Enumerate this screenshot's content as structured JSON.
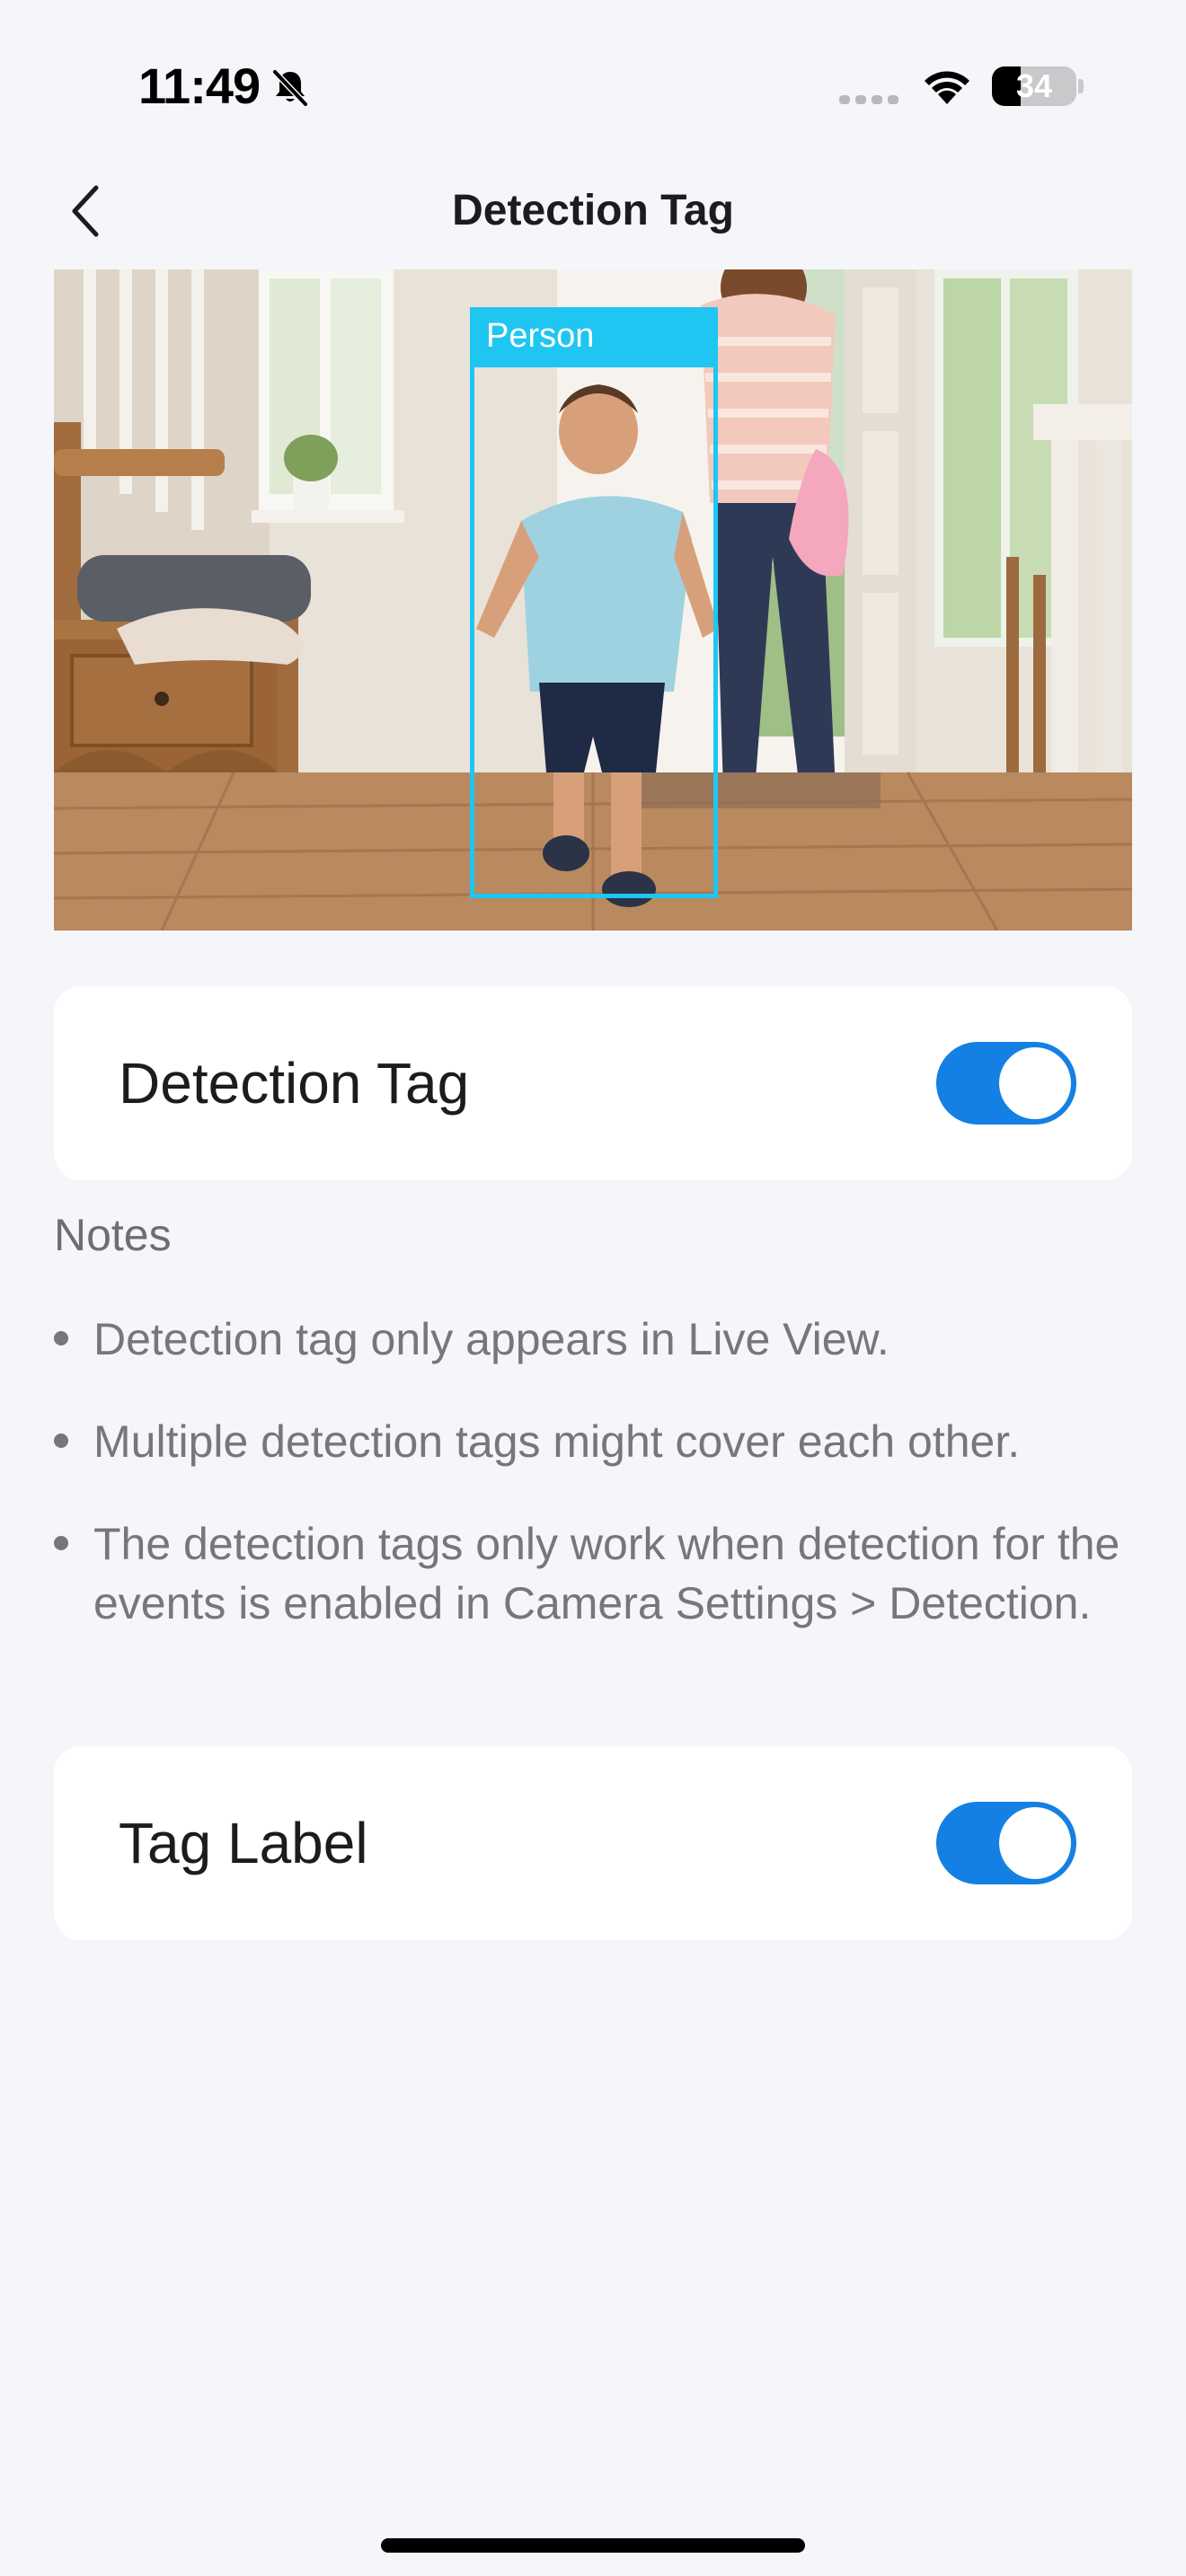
{
  "status_bar": {
    "time": "11:49",
    "battery_level": "34",
    "icons": [
      "bell-slash-icon",
      "cellular-signal-icon",
      "wifi-icon",
      "battery-icon"
    ]
  },
  "nav": {
    "title": "Detection Tag",
    "back_icon": "chevron-left-icon"
  },
  "preview": {
    "detection_label": "Person",
    "accent_color": "#1fc6f2"
  },
  "settings": {
    "detection_tag": {
      "label": "Detection Tag",
      "enabled": true
    },
    "tag_label": {
      "label": "Tag Label",
      "enabled": true
    }
  },
  "notes": {
    "title": "Notes",
    "items": [
      "Detection tag only appears in Live View.",
      "Multiple detection tags might cover each other.",
      "The detection tags only work when detection for the events is enabled in Camera Settings > Detection."
    ]
  },
  "colors": {
    "toggle_on": "#1480e3",
    "background": "#f5f6fa",
    "card": "#ffffff"
  }
}
